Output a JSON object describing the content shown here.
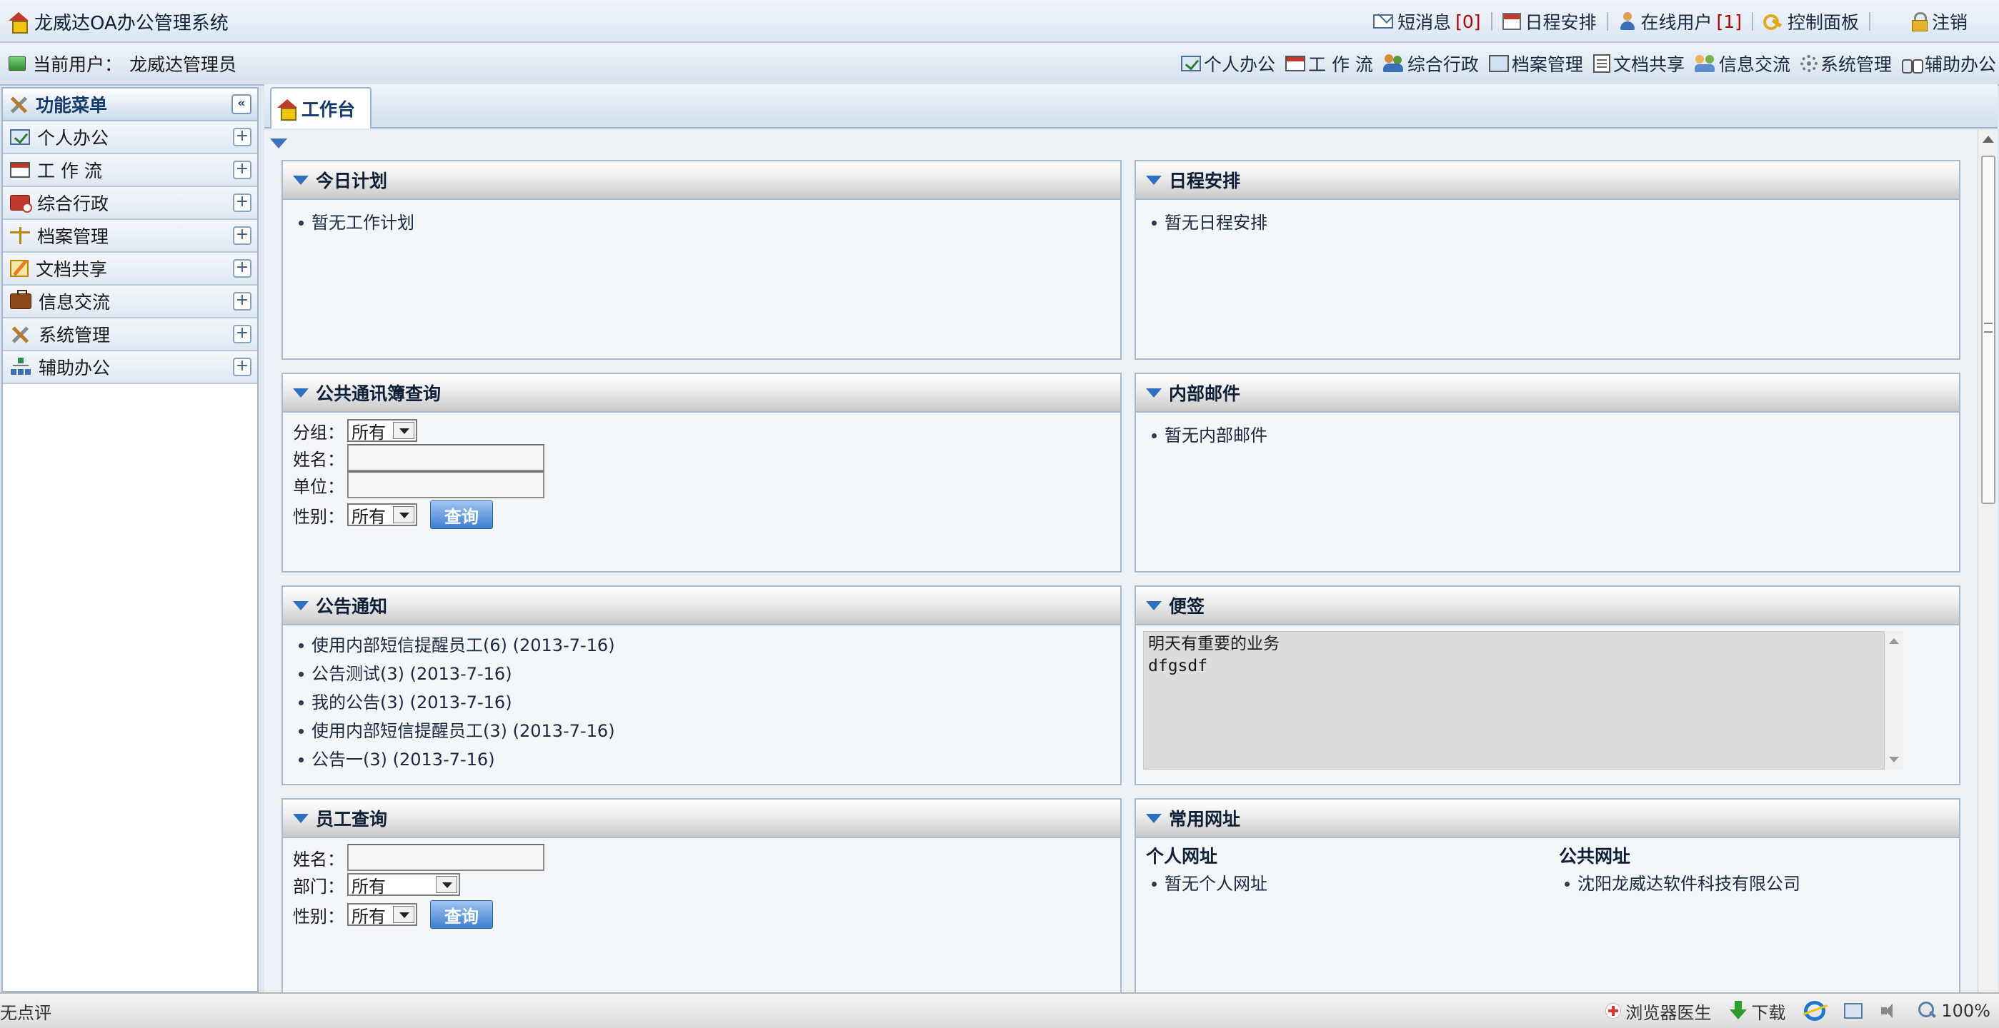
{
  "app": {
    "title": "龙威达OA办公管理系统"
  },
  "top_links": [
    {
      "label": "短消息",
      "count": "[0]",
      "icon": "envelope-icon"
    },
    {
      "label": "日程安排",
      "icon": "calendar-icon"
    },
    {
      "label": "在线用户",
      "count": "[1]",
      "icon": "user-icon"
    },
    {
      "label": "控制面板",
      "icon": "key-icon"
    },
    {
      "label": "注销",
      "icon": "lock-icon"
    }
  ],
  "user_bar": {
    "label": "当前用户：",
    "name": "龙威达管理员"
  },
  "nav_links": [
    {
      "label": "个人办公",
      "icon": "checkbox-icon"
    },
    {
      "label": "工 作 流",
      "icon": "workflow-icon"
    },
    {
      "label": "综合行政",
      "icon": "group-icon"
    },
    {
      "label": "档案管理",
      "icon": "monitor-icon"
    },
    {
      "label": "文档共享",
      "icon": "document-icon"
    },
    {
      "label": "信息交流",
      "icon": "people-icon"
    },
    {
      "label": "系统管理",
      "icon": "gear-icon"
    },
    {
      "label": "辅助办公",
      "icon": "binoculars-icon"
    }
  ],
  "sidebar": {
    "header": "功能菜单",
    "collapse_glyph": "«",
    "items": [
      {
        "label": "个人办公",
        "icon": "checkbox-icon"
      },
      {
        "label": "工 作 流",
        "icon": "workflow-icon"
      },
      {
        "label": "综合行政",
        "icon": "briefcase-red-icon"
      },
      {
        "label": "档案管理",
        "icon": "scale-icon"
      },
      {
        "label": "文档共享",
        "icon": "pencil-icon"
      },
      {
        "label": "信息交流",
        "icon": "briefcase-icon"
      },
      {
        "label": "系统管理",
        "icon": "tools-icon"
      },
      {
        "label": "辅助办公",
        "icon": "tree-icon"
      }
    ]
  },
  "tabs": [
    {
      "label": "工作台",
      "icon": "house-icon"
    }
  ],
  "panels": {
    "today_plan": {
      "title": "今日计划",
      "items": [
        "暂无工作计划"
      ]
    },
    "schedule": {
      "title": "日程安排",
      "items": [
        "暂无日程安排"
      ]
    },
    "address_book": {
      "title": "公共通讯簿查询",
      "group_label": "分组：",
      "group_value": "所有",
      "name_label": "姓名：",
      "unit_label": "单位：",
      "gender_label": "性别：",
      "gender_value": "所有",
      "query_button": "查询"
    },
    "internal_mail": {
      "title": "内部邮件",
      "items": [
        "暂无内部邮件"
      ]
    },
    "notices": {
      "title": "公告通知",
      "items": [
        "使用内部短信提醒员工(6) (2013-7-16)",
        "公告测试(3) (2013-7-16)",
        "我的公告(3) (2013-7-16)",
        "使用内部短信提醒员工(3) (2013-7-16)",
        "公告一(3) (2013-7-16)"
      ]
    },
    "memo": {
      "title": "便签",
      "text": "明天有重要的业务\ndfgsdf"
    },
    "employee_query": {
      "title": "员工查询",
      "name_label": "姓名：",
      "dept_label": "部门：",
      "dept_value": "所有",
      "gender_label": "性别：",
      "gender_value": "所有",
      "query_button": "查询"
    },
    "urls": {
      "title": "常用网址",
      "personal_title": "个人网址",
      "personal_items": [
        "暂无个人网址"
      ],
      "public_title": "公共网址",
      "public_items": [
        "沈阳龙威达软件科技有限公司"
      ]
    }
  },
  "status_bar": {
    "left": "无点评",
    "browser_doctor": "浏览器医生",
    "download": "下载",
    "zoom": "100%"
  }
}
